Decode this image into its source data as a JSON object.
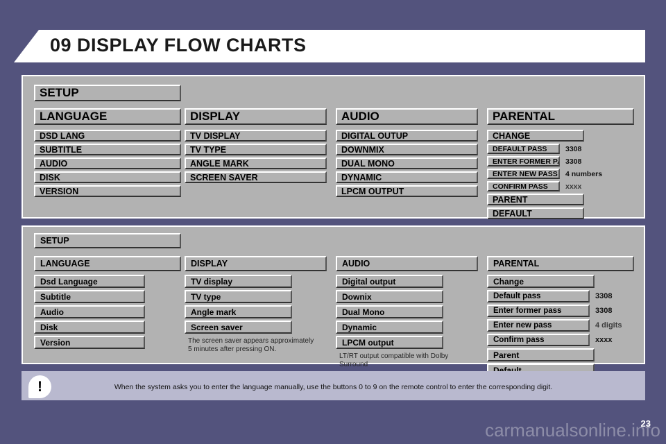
{
  "header": {
    "chapter": "09",
    "title": "09 DISPLAY FLOW CHARTS"
  },
  "colors": {
    "background": "#53537d",
    "panel": "#b2b2b2",
    "banner": "#ffffff",
    "warnbar": "#b9b9cf",
    "watermark": "#8d8da8"
  },
  "upper_panel": {
    "root_label": "SETUP",
    "columns": [
      {
        "title": "LANGUAGE",
        "items": [
          {
            "label": "DSD LANG"
          },
          {
            "label": "SUBTITLE"
          },
          {
            "label": "AUDIO"
          },
          {
            "label": "DISK"
          },
          {
            "label": "VERSION"
          }
        ]
      },
      {
        "title": "DISPLAY",
        "items": [
          {
            "label": "TV DISPLAY"
          },
          {
            "label": "TV TYPE"
          },
          {
            "label": "ANGLE MARK"
          },
          {
            "label": "SCREEN SAVER"
          }
        ]
      },
      {
        "title": "AUDIO",
        "items": [
          {
            "label": "DIGITAL OUTUP"
          },
          {
            "label": "DOWNMIX"
          },
          {
            "label": "DUAL MONO"
          },
          {
            "label": "DYNAMIC"
          },
          {
            "label": "LPCM OUTPUT"
          }
        ]
      },
      {
        "title": "PARENTAL",
        "items": [
          {
            "label": "CHANGE",
            "value": ""
          },
          {
            "label": "DEFAULT PASS",
            "value": "3308"
          },
          {
            "label": "ENTER FORMER PASS",
            "value": "3308"
          },
          {
            "label": "ENTER NEW PASS",
            "value": "4 numbers"
          },
          {
            "label": "CONFIRM PASS",
            "value": "xxxx"
          },
          {
            "label": "PARENT",
            "value": ""
          },
          {
            "label": "DEFAULT",
            "value": ""
          }
        ]
      }
    ]
  },
  "lower_panel": {
    "root_label": "SETUP",
    "columns": [
      {
        "title": "LANGUAGE",
        "items": [
          {
            "label": "Dsd Language"
          },
          {
            "label": "Subtitle"
          },
          {
            "label": "Audio"
          },
          {
            "label": "Disk"
          },
          {
            "label": "Version"
          }
        ],
        "note": ""
      },
      {
        "title": "DISPLAY",
        "items": [
          {
            "label": "TV display"
          },
          {
            "label": "TV type"
          },
          {
            "label": "Angle mark"
          },
          {
            "label": "Screen saver"
          }
        ],
        "note": "The screen saver appears approximately 5 minutes after pressing ON."
      },
      {
        "title": "AUDIO",
        "items": [
          {
            "label": "Digital output"
          },
          {
            "label": "Downix"
          },
          {
            "label": "Dual Mono"
          },
          {
            "label": "Dynamic"
          },
          {
            "label": "LPCM output"
          }
        ],
        "note": "LT/RT output compatible with Dolby Surround"
      },
      {
        "title": "PARENTAL",
        "items": [
          {
            "label": "Change",
            "value": ""
          },
          {
            "label": "Default pass",
            "value": "3308"
          },
          {
            "label": "Enter former pass",
            "value": "3308"
          },
          {
            "label": "Enter new pass",
            "value": "4 digits"
          },
          {
            "label": "Confirm pass",
            "value": "xxxx"
          },
          {
            "label": "Parent",
            "value": ""
          },
          {
            "label": "Default",
            "value": ""
          }
        ],
        "note": ""
      }
    ]
  },
  "warning": {
    "icon": "!",
    "text": "When the system asks you to enter the language manually, use the buttons 0 to 9 on the remote control to enter the corresponding digit."
  },
  "footer": {
    "page_number": "23",
    "watermark": "carmanualsonline.info"
  }
}
